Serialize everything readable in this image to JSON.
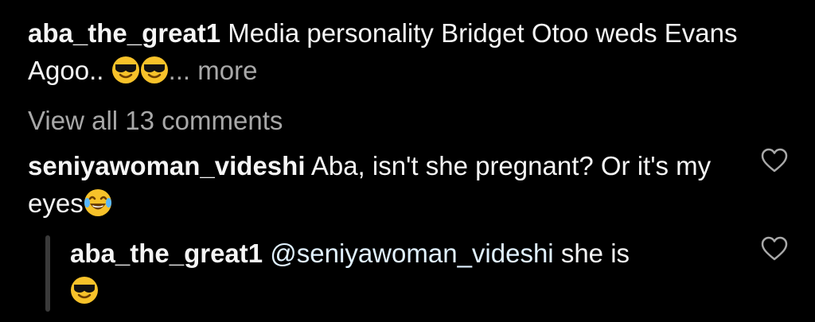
{
  "post_caption": {
    "username": "aba_the_great1",
    "text": "Media personality Bridget Otoo weds Evans Agoo..",
    "ellipsis": "...",
    "more_label": "more",
    "emojis": [
      "sunglasses-emoji",
      "sunglasses-emoji"
    ]
  },
  "comments_link": {
    "label": "View all 13 comments"
  },
  "comments": [
    {
      "username": "seniyawoman_videshi",
      "text": "Aba, isn't she pregnant? Or it's my eyes",
      "emoji": "tears-of-joy-emoji",
      "like_icon": "heart-icon"
    }
  ],
  "replies": [
    {
      "username": "aba_the_great1",
      "mention": "@seniyawoman_videshi",
      "text": "she is",
      "emoji": "sunglasses-emoji",
      "like_icon": "heart-icon"
    }
  ],
  "colors": {
    "background": "#000000",
    "primary_text": "#f5f5f5",
    "muted_text": "#a8a8a8",
    "mention_text": "#e0f1ff",
    "thread_line": "#3a3a3a"
  }
}
